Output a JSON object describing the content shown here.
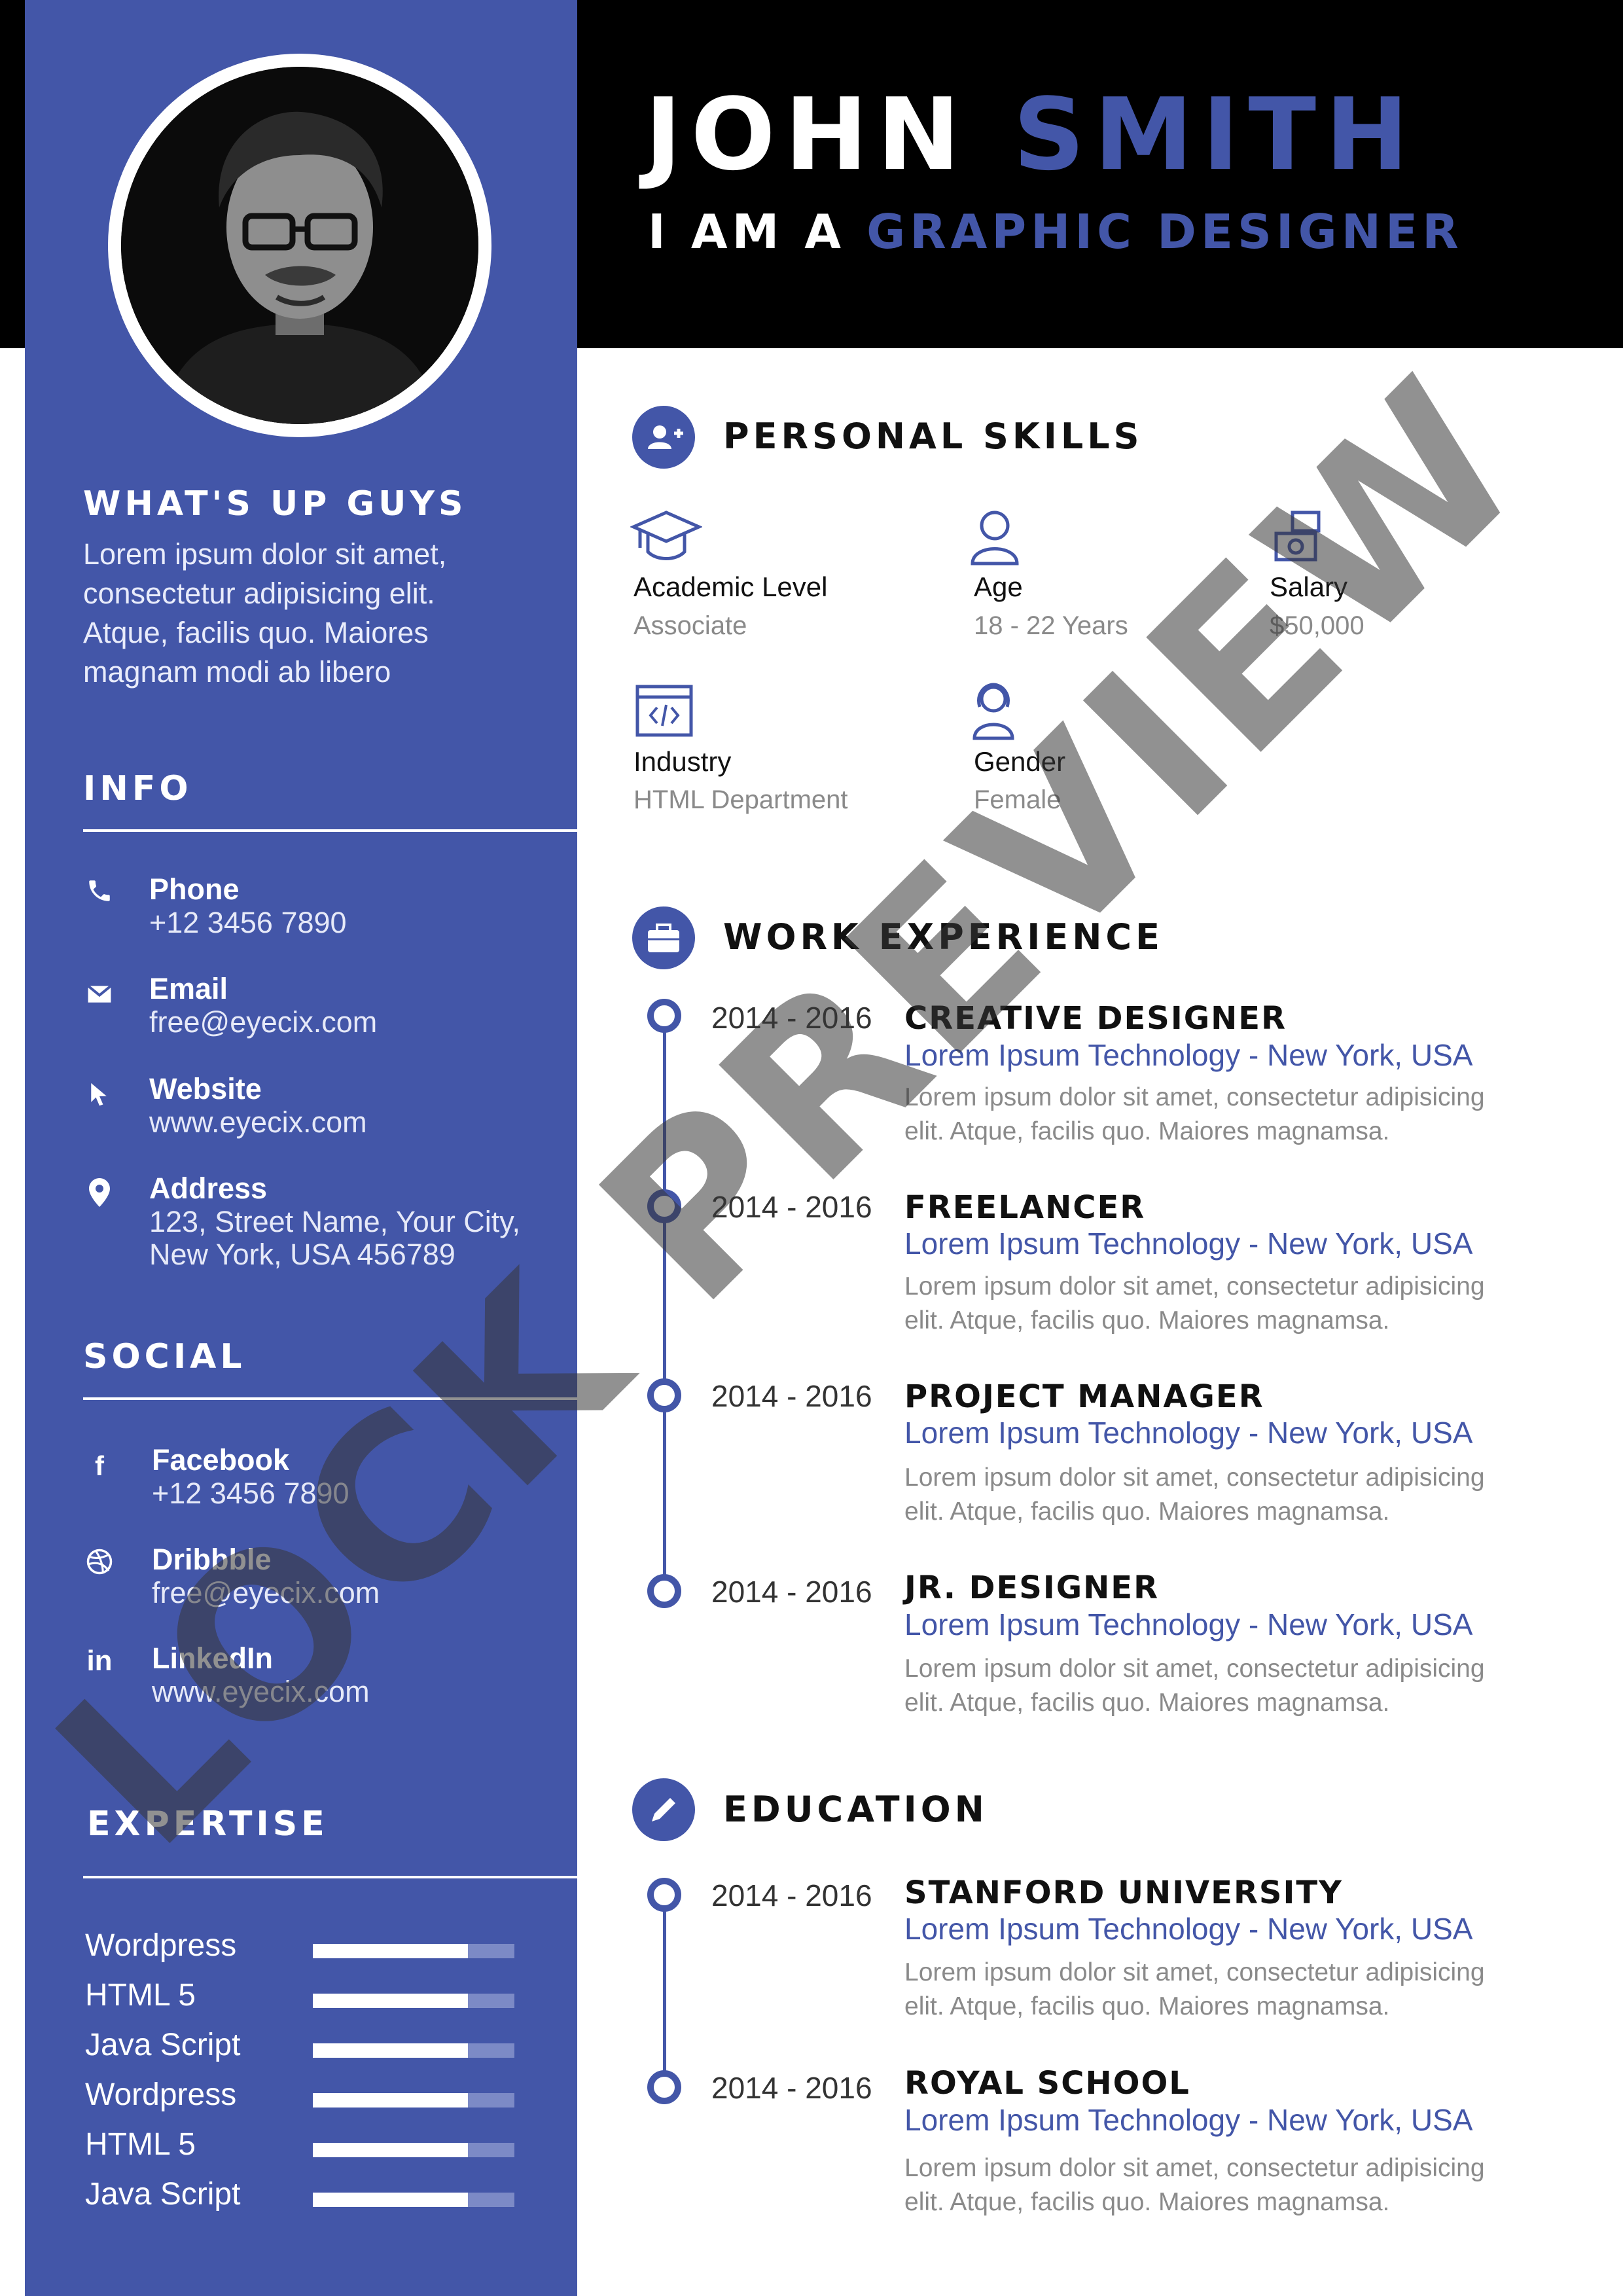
{
  "header": {
    "first_name": "JOHN",
    "last_name": "SMITH",
    "role_prefix": "I AM A",
    "role": "GRAPHIC DESIGNER"
  },
  "colors": {
    "accent": "#4356a8",
    "header_bg": "#000000",
    "text_dark": "#111111",
    "text_muted": "#8a8a8a"
  },
  "sidebar": {
    "intro_title": "WHAT'S UP GUYS",
    "intro_lines": [
      "Lorem ipsum dolor sit amet,",
      "consectetur adipisicing elit.",
      "Atque, facilis quo. Maiores",
      "magnam modi ab libero"
    ],
    "info_title": "INFO",
    "info": [
      {
        "icon": "phone-icon",
        "label": "Phone",
        "value": "+12 3456 7890"
      },
      {
        "icon": "email-icon",
        "label": "Email",
        "value": "free@eyecix.com"
      },
      {
        "icon": "cursor-icon",
        "label": "Website",
        "value": "www.eyecix.com"
      },
      {
        "icon": "location-pin-icon",
        "label": "Address",
        "value": "123, Street Name, Your City,",
        "value2": "New York, USA 456789"
      }
    ],
    "social_title": "SOCIAL",
    "social": [
      {
        "icon": "facebook-icon",
        "label": "Facebook",
        "value": "+12 3456 7890"
      },
      {
        "icon": "dribbble-icon",
        "label": "Dribbble",
        "value": "free@eyecix.com"
      },
      {
        "icon": "linkedin-icon",
        "label": "LinkedIn",
        "value": "www.eyecix.com"
      }
    ],
    "expertise_title": "EXPERTISE",
    "expertise": [
      {
        "name": "Wordpress",
        "level": 0.77
      },
      {
        "name": "HTML 5",
        "level": 0.77
      },
      {
        "name": "Java Script",
        "level": 0.77
      },
      {
        "name": "Wordpress",
        "level": 0.77
      },
      {
        "name": "HTML 5",
        "level": 0.77
      },
      {
        "name": "Java Script",
        "level": 0.77
      }
    ]
  },
  "personal_skills": {
    "title": "PERSONAL SKILLS",
    "items": [
      {
        "icon": "graduation-cap-icon",
        "label": "Academic Level",
        "value": "Associate"
      },
      {
        "icon": "user-icon",
        "label": "Age",
        "value": "18 - 22 Years"
      },
      {
        "icon": "money-icon",
        "label": "Salary",
        "value": "$50,000"
      },
      {
        "icon": "code-window-icon",
        "label": "Industry",
        "value": "HTML Department"
      },
      {
        "icon": "female-icon",
        "label": "Gender",
        "value": "Female"
      }
    ]
  },
  "work": {
    "title": "WORK EXPERIENCE",
    "items": [
      {
        "years": "2014 - 2016",
        "title": "CREATIVE DESIGNER",
        "company": "Lorem Ipsum Technology - New York, USA",
        "desc1": "Lorem ipsum dolor sit amet, consectetur adipisicing",
        "desc2": "elit. Atque, facilis quo. Maiores magnamsa."
      },
      {
        "years": "2014 - 2016",
        "title": "FREELANCER",
        "company": "Lorem Ipsum Technology - New York, USA",
        "desc1": "Lorem ipsum dolor sit amet, consectetur adipisicing",
        "desc2": "elit. Atque, facilis quo. Maiores magnamsa."
      },
      {
        "years": "2014 - 2016",
        "title": "PROJECT MANAGER",
        "company": "Lorem Ipsum Technology - New York, USA",
        "desc1": "Lorem ipsum dolor sit amet, consectetur adipisicing",
        "desc2": "elit. Atque, facilis quo. Maiores magnamsa."
      },
      {
        "years": "2014 - 2016",
        "title": "JR. DESIGNER",
        "company": "Lorem Ipsum Technology - New York, USA",
        "desc1": "Lorem ipsum dolor sit amet, consectetur adipisicing",
        "desc2": "elit. Atque, facilis quo. Maiores magnamsa."
      }
    ]
  },
  "education": {
    "title": "EDUCATION",
    "items": [
      {
        "years": "2014 - 2016",
        "title": "STANFORD UNIVERSITY",
        "company": "Lorem Ipsum Technology - New York, USA",
        "desc1": "Lorem ipsum dolor sit amet, consectetur adipisicing",
        "desc2": "elit. Atque, facilis quo. Maiores magnamsa."
      },
      {
        "years": "2014 - 2016",
        "title": "ROYAL SCHOOL",
        "company": "Lorem Ipsum Technology - New York, USA",
        "desc1": "Lorem ipsum dolor sit amet, consectetur adipisicing",
        "desc2": "elit. Atque, facilis quo. Maiores magnamsa."
      }
    ]
  },
  "watermark": "LOCK PREVIEW"
}
